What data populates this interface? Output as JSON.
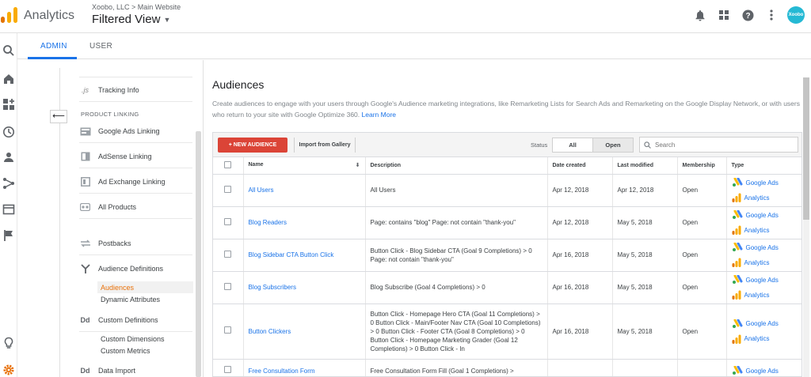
{
  "header": {
    "app_title": "Analytics",
    "breadcrumb": "Xoobo, LLC > Main Website",
    "view_name": "Filtered View",
    "avatar_text": "Xoobo",
    "icons": [
      "bell-icon",
      "apps-grid-icon",
      "help-icon",
      "more-vert-icon"
    ]
  },
  "tabs": [
    {
      "label": "ADMIN",
      "active": true
    },
    {
      "label": "USER",
      "active": false
    }
  ],
  "nav": {
    "section_product_linking": "PRODUCT LINKING",
    "tracking_info_prefix": ".js",
    "items": {
      "tracking_info": "Tracking Info",
      "google_ads_linking": "Google Ads Linking",
      "adsense_linking": "AdSense Linking",
      "ad_exchange_linking": "Ad Exchange Linking",
      "all_products": "All Products",
      "postbacks": "Postbacks",
      "audience_definitions": "Audience Definitions",
      "audiences": "Audiences",
      "dynamic_attributes": "Dynamic Attributes",
      "custom_definitions": "Custom Definitions",
      "custom_dimensions": "Custom Dimensions",
      "custom_metrics": "Custom Metrics",
      "data_import": "Data Import",
      "dd_glyph": "Dd"
    }
  },
  "main": {
    "title": "Audiences",
    "intro": "Create audiences to engage with your users through Google's Audience marketing integrations, like Remarketing Lists for Search Ads and Remarketing on the Google Display Network, or with users who return to your site with Google Optimize 360.",
    "learn_more": "Learn More",
    "new_audience_label": "+ NEW AUDIENCE",
    "import_label": "Import from Gallery",
    "status_label": "Status",
    "status_all": "All",
    "status_open": "Open",
    "search_placeholder": "Search",
    "columns": [
      "Name",
      "Description",
      "Date created",
      "Last modified",
      "Membership",
      "Type"
    ],
    "type_google_ads": "Google Ads",
    "type_analytics": "Analytics",
    "rows": [
      {
        "name": "All Users",
        "description": "All Users",
        "date_created": "Apr 12, 2018",
        "last_modified": "Apr 12, 2018",
        "membership": "Open"
      },
      {
        "name": "Blog Readers",
        "description": "Page: contains \"blog\" Page: not contain \"thank-you\"",
        "date_created": "Apr 12, 2018",
        "last_modified": "May 5, 2018",
        "membership": "Open"
      },
      {
        "name": "Blog Sidebar CTA Button Click",
        "description": "Button Click - Blog Sidebar CTA (Goal 9 Completions) > 0 Page: not contain \"thank-you\"",
        "date_created": "Apr 16, 2018",
        "last_modified": "May 5, 2018",
        "membership": "Open"
      },
      {
        "name": "Blog Subscribers",
        "description": "Blog Subscribe (Goal 4 Completions) > 0",
        "date_created": "Apr 16, 2018",
        "last_modified": "May 5, 2018",
        "membership": "Open"
      },
      {
        "name": "Button Clickers",
        "description": "Button Click - Homepage Hero CTA (Goal 11 Completions) > 0 Button Click - Main/Footer Nav CTA (Goal 10 Completions) > 0 Button Click - Footer CTA (Goal 8 Completions) > 0 Button Click - Homepage Marketing Grader (Goal 12 Completions) > 0 Button Click - In",
        "date_created": "Apr 16, 2018",
        "last_modified": "May 5, 2018",
        "membership": "Open"
      },
      {
        "name": "Free Consultation Form",
        "description": "Free Consultation Form Fill (Goal 1 Completions) >",
        "date_created": "",
        "last_modified": "",
        "membership": ""
      }
    ]
  },
  "colors": {
    "accent": "#1a73e8",
    "new_button": "#db4437",
    "active_nav": "#e8710a",
    "settings_gear": "#e8710a",
    "logo_orange": "#f9ab00",
    "logo_dark": "#e37400"
  }
}
